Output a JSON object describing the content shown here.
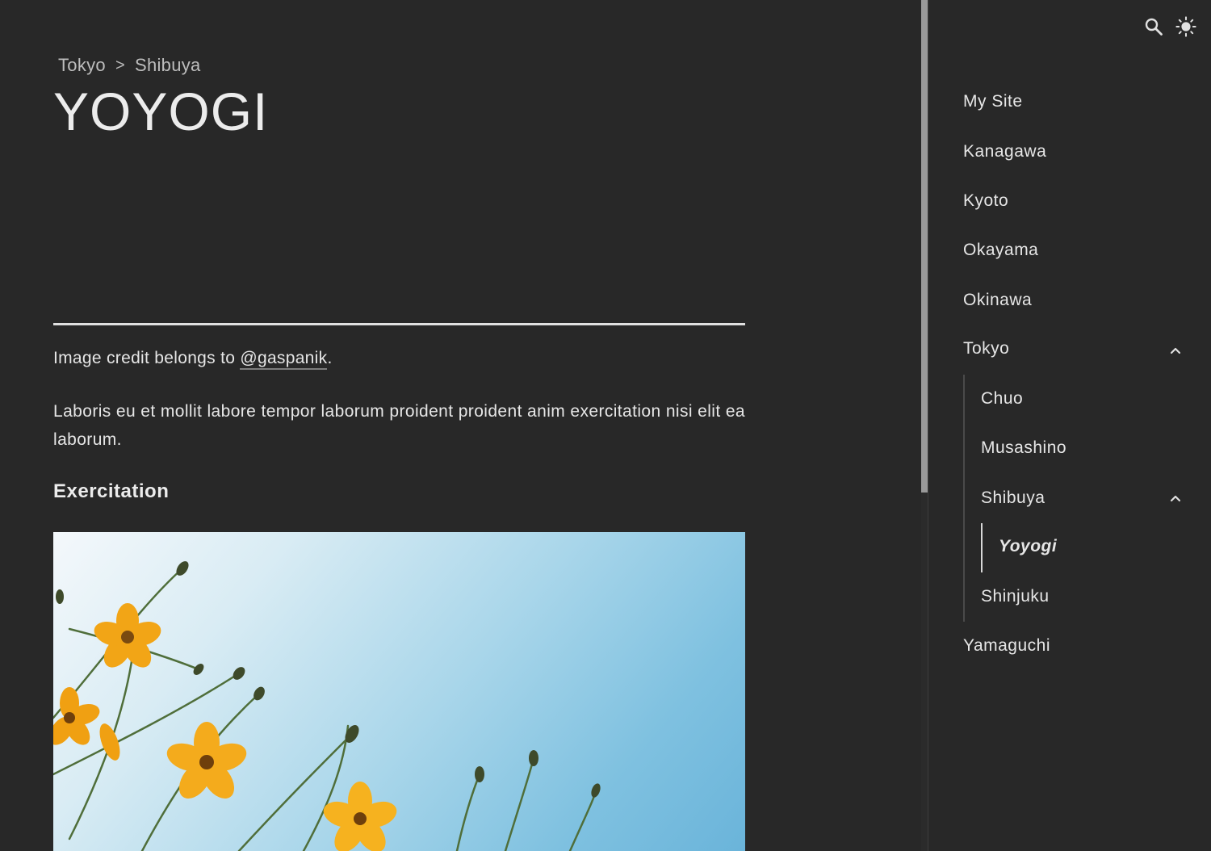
{
  "breadcrumb": {
    "items": [
      "Tokyo",
      "Shibuya"
    ],
    "separator": ">"
  },
  "page": {
    "title": "YOYOGI"
  },
  "content": {
    "credit_prefix": "Image credit belongs to ",
    "credit_link": "@gaspanik",
    "credit_suffix": ".",
    "paragraph": "Laboris eu et mollit labore tempor laborum proident proident anim exercitation nisi elit ea laborum.",
    "heading": "Exercitation"
  },
  "toolbar": {
    "search_icon": "search-icon",
    "theme_icon": "sun-icon"
  },
  "sidebar": {
    "items": [
      {
        "label": "My Site"
      },
      {
        "label": "Kanagawa"
      },
      {
        "label": "Kyoto"
      },
      {
        "label": "Okayama"
      },
      {
        "label": "Okinawa"
      },
      {
        "label": "Tokyo",
        "expanded": true
      },
      {
        "label": "Chuo"
      },
      {
        "label": "Musashino"
      },
      {
        "label": "Shibuya",
        "expanded": true
      },
      {
        "label": "Yoyogi",
        "active": true
      },
      {
        "label": "Shinjuku"
      },
      {
        "label": "Yamaguchi"
      }
    ]
  },
  "colors": {
    "background": "#282828",
    "text": "#e6e6e6",
    "scrollbar_thumb": "#9a9a9a",
    "sky": "#7fc1e0",
    "flower": "#f2a516"
  }
}
